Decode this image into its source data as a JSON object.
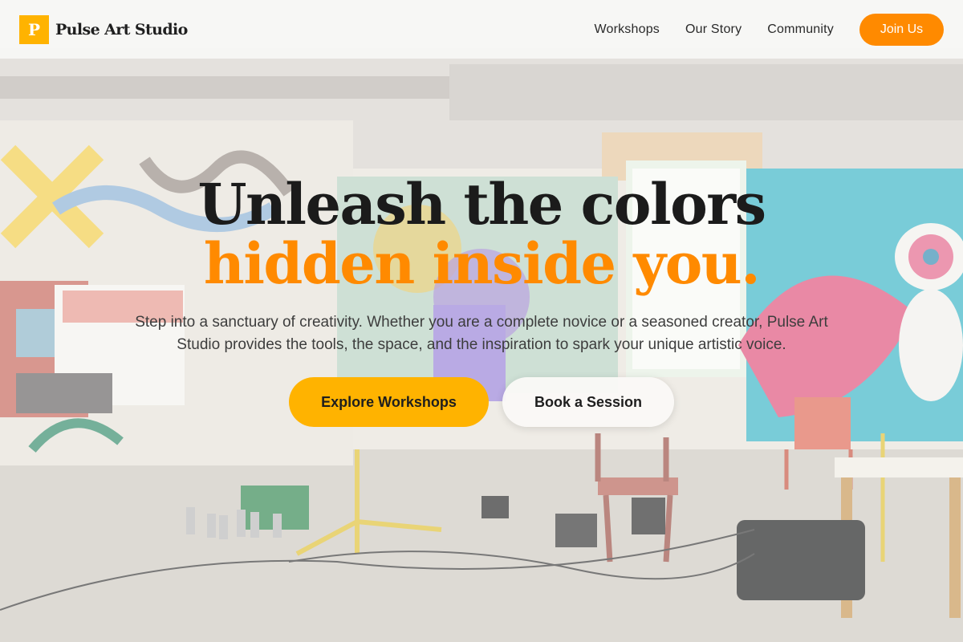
{
  "colors": {
    "brand_primary": "#ffb300",
    "accent_orange": "#ff8a00",
    "text_dark": "#1b1b1b",
    "text_body": "#3d3d3d"
  },
  "header": {
    "logo_letter": "P",
    "brand_name": "Pulse Art Studio",
    "nav": [
      {
        "label": "Workshops"
      },
      {
        "label": "Our Story"
      },
      {
        "label": "Community"
      }
    ],
    "join_label": "Join Us"
  },
  "hero": {
    "title_line1": "Unleash the colors",
    "title_line2": "hidden inside you.",
    "subtitle": "Step into a sanctuary of creativity. Whether you are a complete novice or a seasoned creator, Pulse Art Studio provides the tools, the space, and the inspiration to spark your unique artistic voice.",
    "primary_cta": "Explore Workshops",
    "secondary_cta": "Book a Session"
  },
  "background": {
    "icon": "art-studio-photo-icon"
  }
}
